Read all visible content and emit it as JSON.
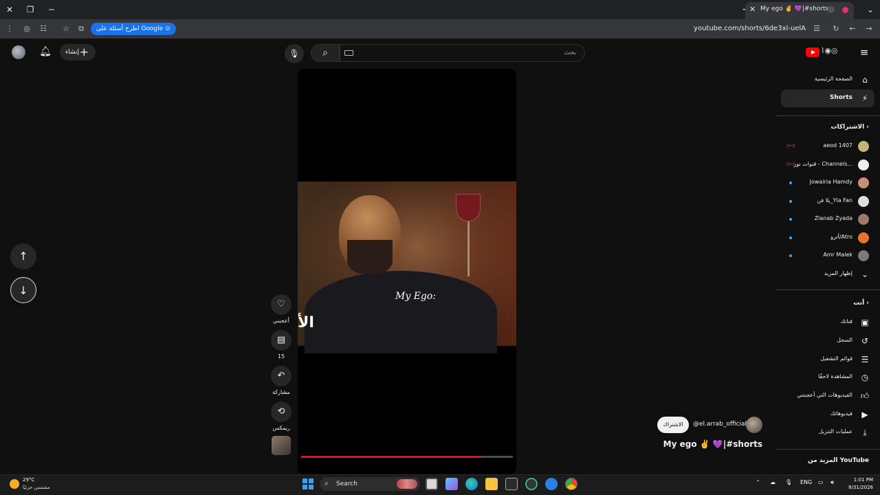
{
  "browser": {
    "tab_title": "My ego ✌️ 💜|#shorts - You...",
    "url": "youtube.com/shorts/6de3xl-uelA",
    "google_chip": "اطرح أسئلة على Google"
  },
  "header": {
    "create_label": "إنشاء",
    "search_placeholder": "بحث"
  },
  "video": {
    "caption": "My Ego:",
    "arabic_caption": "الأ",
    "progress": 0.85
  },
  "actions": {
    "like_label": "أعجبني",
    "comments_count": "15",
    "share_label": "مشاركة",
    "remix_label": "ريمكس"
  },
  "channel": {
    "subscribe_label": "الاشتراك",
    "name": "@el.arrab_official",
    "video_title": "My ego ✌️ 💜|#shorts"
  },
  "sidebar": {
    "home": "الصفحة الرئيسية",
    "shorts": "Shorts",
    "subscriptions_header": "الاشتراكات",
    "subscriptions": [
      {
        "name": "aeod 1407",
        "indicator": "live"
      },
      {
        "name": "قنوات نور - Channels...",
        "indicator": "live"
      },
      {
        "name": "Jowairia Hamdy",
        "indicator": "dot"
      },
      {
        "name": "يلا فن_Yla Fan",
        "indicator": "dot"
      },
      {
        "name": "Zianab Zyada",
        "indicator": "dot"
      },
      {
        "name": "أترو/Atro",
        "indicator": "dot"
      },
      {
        "name": "Amr Malek",
        "indicator": "dot"
      }
    ],
    "show_more": "إظهار المزيد",
    "you_header": "أنت",
    "you_items": [
      "قناتك",
      "السجل",
      "قوائم التشغيل",
      "المشاهدة لاحقًا",
      "الفيديوهات التي أعجبتني",
      "فيديوهاتك",
      "عمليات التنزيل"
    ],
    "more_from": "المزيد من YouTube"
  },
  "taskbar": {
    "temperature": "29°C",
    "weather_desc": "مشمس جزئيًا",
    "search_label": "Search",
    "lang": "ENG",
    "time": "1:01 PM",
    "date": "8/31/2026"
  },
  "colors": {
    "accent": "#ff0033",
    "background": "#0f0f0f",
    "chip": "#1a73e8"
  }
}
